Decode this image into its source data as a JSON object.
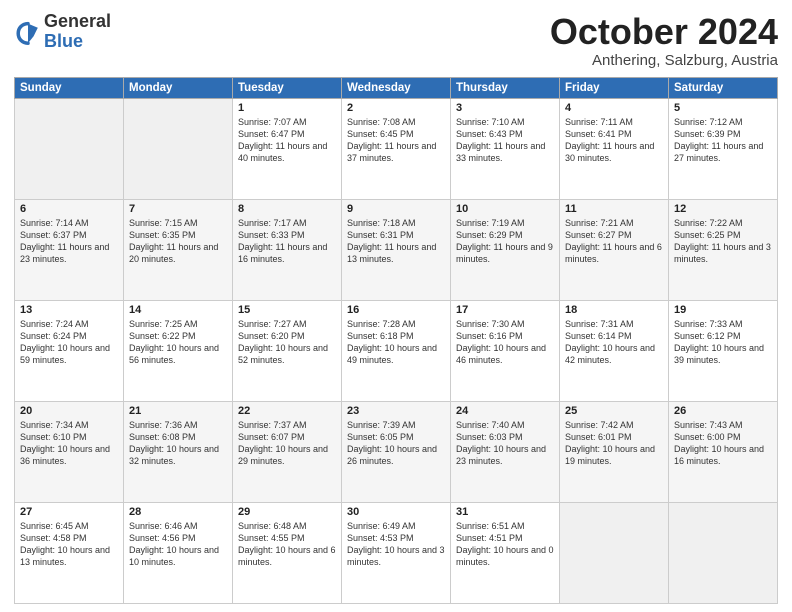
{
  "header": {
    "logo_general": "General",
    "logo_blue": "Blue",
    "month_title": "October 2024",
    "location": "Anthering, Salzburg, Austria"
  },
  "weekdays": [
    "Sunday",
    "Monday",
    "Tuesday",
    "Wednesday",
    "Thursday",
    "Friday",
    "Saturday"
  ],
  "weeks": [
    [
      {
        "day": "",
        "sunrise": "",
        "sunset": "",
        "daylight": ""
      },
      {
        "day": "",
        "sunrise": "",
        "sunset": "",
        "daylight": ""
      },
      {
        "day": "1",
        "sunrise": "Sunrise: 7:07 AM",
        "sunset": "Sunset: 6:47 PM",
        "daylight": "Daylight: 11 hours and 40 minutes."
      },
      {
        "day": "2",
        "sunrise": "Sunrise: 7:08 AM",
        "sunset": "Sunset: 6:45 PM",
        "daylight": "Daylight: 11 hours and 37 minutes."
      },
      {
        "day": "3",
        "sunrise": "Sunrise: 7:10 AM",
        "sunset": "Sunset: 6:43 PM",
        "daylight": "Daylight: 11 hours and 33 minutes."
      },
      {
        "day": "4",
        "sunrise": "Sunrise: 7:11 AM",
        "sunset": "Sunset: 6:41 PM",
        "daylight": "Daylight: 11 hours and 30 minutes."
      },
      {
        "day": "5",
        "sunrise": "Sunrise: 7:12 AM",
        "sunset": "Sunset: 6:39 PM",
        "daylight": "Daylight: 11 hours and 27 minutes."
      }
    ],
    [
      {
        "day": "6",
        "sunrise": "Sunrise: 7:14 AM",
        "sunset": "Sunset: 6:37 PM",
        "daylight": "Daylight: 11 hours and 23 minutes."
      },
      {
        "day": "7",
        "sunrise": "Sunrise: 7:15 AM",
        "sunset": "Sunset: 6:35 PM",
        "daylight": "Daylight: 11 hours and 20 minutes."
      },
      {
        "day": "8",
        "sunrise": "Sunrise: 7:17 AM",
        "sunset": "Sunset: 6:33 PM",
        "daylight": "Daylight: 11 hours and 16 minutes."
      },
      {
        "day": "9",
        "sunrise": "Sunrise: 7:18 AM",
        "sunset": "Sunset: 6:31 PM",
        "daylight": "Daylight: 11 hours and 13 minutes."
      },
      {
        "day": "10",
        "sunrise": "Sunrise: 7:19 AM",
        "sunset": "Sunset: 6:29 PM",
        "daylight": "Daylight: 11 hours and 9 minutes."
      },
      {
        "day": "11",
        "sunrise": "Sunrise: 7:21 AM",
        "sunset": "Sunset: 6:27 PM",
        "daylight": "Daylight: 11 hours and 6 minutes."
      },
      {
        "day": "12",
        "sunrise": "Sunrise: 7:22 AM",
        "sunset": "Sunset: 6:25 PM",
        "daylight": "Daylight: 11 hours and 3 minutes."
      }
    ],
    [
      {
        "day": "13",
        "sunrise": "Sunrise: 7:24 AM",
        "sunset": "Sunset: 6:24 PM",
        "daylight": "Daylight: 10 hours and 59 minutes."
      },
      {
        "day": "14",
        "sunrise": "Sunrise: 7:25 AM",
        "sunset": "Sunset: 6:22 PM",
        "daylight": "Daylight: 10 hours and 56 minutes."
      },
      {
        "day": "15",
        "sunrise": "Sunrise: 7:27 AM",
        "sunset": "Sunset: 6:20 PM",
        "daylight": "Daylight: 10 hours and 52 minutes."
      },
      {
        "day": "16",
        "sunrise": "Sunrise: 7:28 AM",
        "sunset": "Sunset: 6:18 PM",
        "daylight": "Daylight: 10 hours and 49 minutes."
      },
      {
        "day": "17",
        "sunrise": "Sunrise: 7:30 AM",
        "sunset": "Sunset: 6:16 PM",
        "daylight": "Daylight: 10 hours and 46 minutes."
      },
      {
        "day": "18",
        "sunrise": "Sunrise: 7:31 AM",
        "sunset": "Sunset: 6:14 PM",
        "daylight": "Daylight: 10 hours and 42 minutes."
      },
      {
        "day": "19",
        "sunrise": "Sunrise: 7:33 AM",
        "sunset": "Sunset: 6:12 PM",
        "daylight": "Daylight: 10 hours and 39 minutes."
      }
    ],
    [
      {
        "day": "20",
        "sunrise": "Sunrise: 7:34 AM",
        "sunset": "Sunset: 6:10 PM",
        "daylight": "Daylight: 10 hours and 36 minutes."
      },
      {
        "day": "21",
        "sunrise": "Sunrise: 7:36 AM",
        "sunset": "Sunset: 6:08 PM",
        "daylight": "Daylight: 10 hours and 32 minutes."
      },
      {
        "day": "22",
        "sunrise": "Sunrise: 7:37 AM",
        "sunset": "Sunset: 6:07 PM",
        "daylight": "Daylight: 10 hours and 29 minutes."
      },
      {
        "day": "23",
        "sunrise": "Sunrise: 7:39 AM",
        "sunset": "Sunset: 6:05 PM",
        "daylight": "Daylight: 10 hours and 26 minutes."
      },
      {
        "day": "24",
        "sunrise": "Sunrise: 7:40 AM",
        "sunset": "Sunset: 6:03 PM",
        "daylight": "Daylight: 10 hours and 23 minutes."
      },
      {
        "day": "25",
        "sunrise": "Sunrise: 7:42 AM",
        "sunset": "Sunset: 6:01 PM",
        "daylight": "Daylight: 10 hours and 19 minutes."
      },
      {
        "day": "26",
        "sunrise": "Sunrise: 7:43 AM",
        "sunset": "Sunset: 6:00 PM",
        "daylight": "Daylight: 10 hours and 16 minutes."
      }
    ],
    [
      {
        "day": "27",
        "sunrise": "Sunrise: 6:45 AM",
        "sunset": "Sunset: 4:58 PM",
        "daylight": "Daylight: 10 hours and 13 minutes."
      },
      {
        "day": "28",
        "sunrise": "Sunrise: 6:46 AM",
        "sunset": "Sunset: 4:56 PM",
        "daylight": "Daylight: 10 hours and 10 minutes."
      },
      {
        "day": "29",
        "sunrise": "Sunrise: 6:48 AM",
        "sunset": "Sunset: 4:55 PM",
        "daylight": "Daylight: 10 hours and 6 minutes."
      },
      {
        "day": "30",
        "sunrise": "Sunrise: 6:49 AM",
        "sunset": "Sunset: 4:53 PM",
        "daylight": "Daylight: 10 hours and 3 minutes."
      },
      {
        "day": "31",
        "sunrise": "Sunrise: 6:51 AM",
        "sunset": "Sunset: 4:51 PM",
        "daylight": "Daylight: 10 hours and 0 minutes."
      },
      {
        "day": "",
        "sunrise": "",
        "sunset": "",
        "daylight": ""
      },
      {
        "day": "",
        "sunrise": "",
        "sunset": "",
        "daylight": ""
      }
    ]
  ]
}
